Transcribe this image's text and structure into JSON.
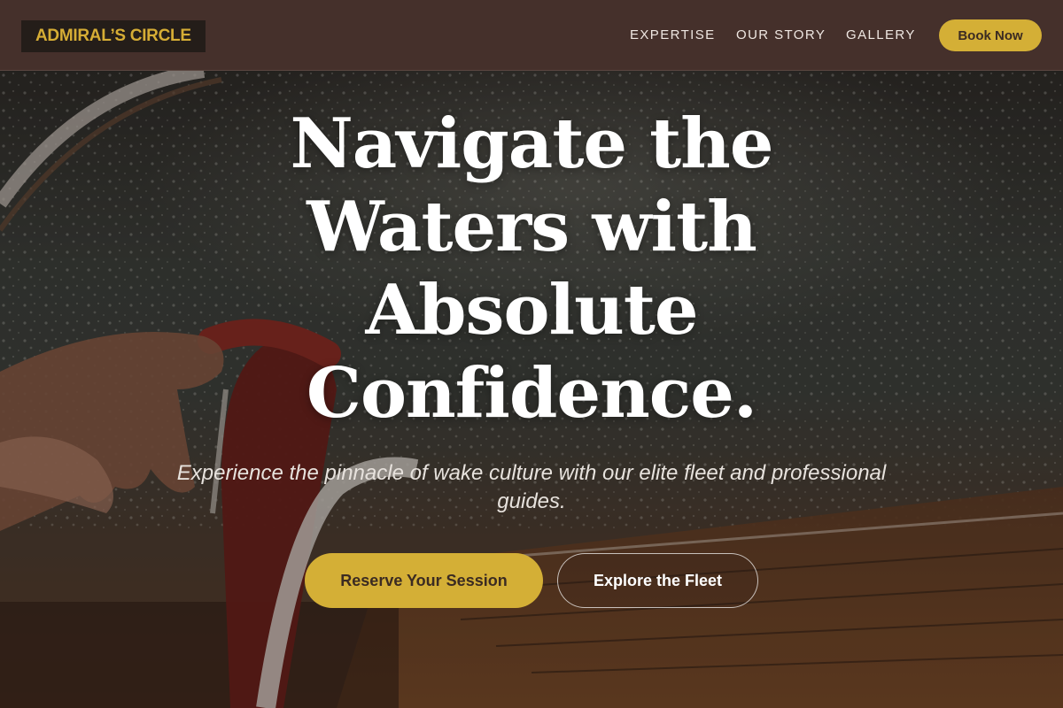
{
  "header": {
    "logo": "ADMIRAL’S CIRCLE",
    "nav": [
      {
        "label": "EXPERTISE"
      },
      {
        "label": "OUR STORY"
      },
      {
        "label": "GALLERY"
      }
    ],
    "book_label": "Book Now"
  },
  "hero": {
    "headline_lines": [
      "Navigate the",
      "Waters with",
      "Absolute",
      "Confidence."
    ],
    "subtitle": "Experience the pinnacle of wake culture with our elite fleet and professional guides.",
    "primary_cta": "Reserve Your Session",
    "secondary_cta": "Explore the Fleet"
  },
  "colors": {
    "header_bg": "#45302b",
    "accent_gold": "#d4af36",
    "logo_bg": "#241d19"
  }
}
